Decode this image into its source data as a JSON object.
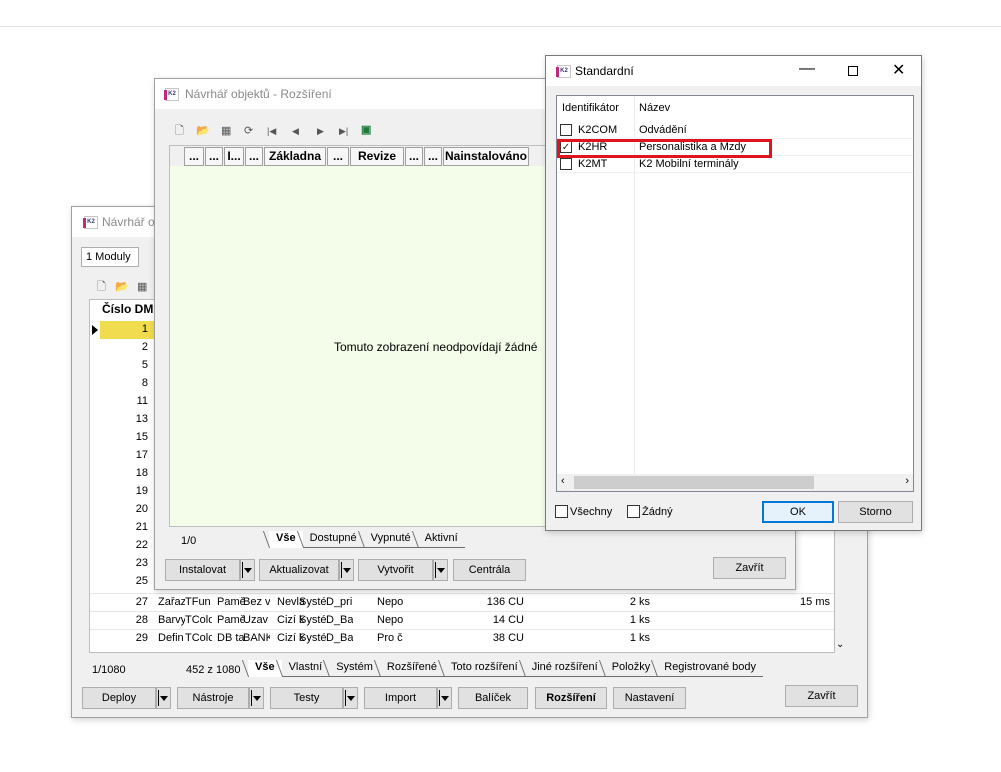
{
  "main_window": {
    "title": "Návrhář ob",
    "module_tab": "1 Moduly",
    "col_header": "Číslo DM",
    "row_numbers": [
      "1",
      "2",
      "5",
      "8",
      "11",
      "13",
      "15",
      "17",
      "18",
      "19",
      "20",
      "21",
      "22",
      "23",
      "25"
    ],
    "rows": [
      {
        "n": "27",
        "c1": "Zařaz",
        "c2": "TFun",
        "c3": "Pamě",
        "c4": "Bez v",
        "c5": "Nevla",
        "c6": "Systé",
        "c7": "D_pri sr",
        "c8": "Nepo",
        "c9": "136 CU",
        "c10": "2 ks",
        "c11": "15 ms"
      },
      {
        "n": "28",
        "c1": "Barvy",
        "c2": "TColc",
        "c3": "Pamě",
        "c4": "Uzav",
        "c5": "Cizí k",
        "c6": "Systé",
        "c7": "D_Ba nz",
        "c8": "Nepo",
        "c9": "14 CU",
        "c10": "1 ks",
        "c11": ""
      },
      {
        "n": "29",
        "c1": "Defin",
        "c2": "TColc",
        "c3": "DB ta",
        "c4": "BANK Bez v",
        "c5": "Cizí k",
        "c6": "Systé",
        "c7": "D_Ba lm",
        "c8": "Pro č",
        "c9": "38 CU",
        "c10": "1 ks",
        "c11": ""
      }
    ],
    "status_left": "1/1080",
    "status_count": "452 z 1080",
    "tabs": [
      "Vše",
      "Vlastní",
      "Systém",
      "Rozšířené",
      "Toto rozšíření",
      "Jiné rozšíření",
      "Položky",
      "Registrované body"
    ],
    "buttons": {
      "deploy": "Deploy",
      "tools": "Nástroje",
      "tests": "Testy",
      "import": "Import",
      "package": "Balíček",
      "extensions": "Rozšíření",
      "settings": "Nastavení",
      "close": "Zavřít"
    }
  },
  "designer_window": {
    "title": "Návrhář objektů - Rozšíření",
    "columns": [
      "...",
      "...",
      "I...",
      "...",
      "Základna",
      "...",
      "Revize",
      "...",
      "...",
      "Nainstalováno"
    ],
    "empty_message": "Tomuto zobrazení neodpovídají žádné",
    "status_left": "1/0",
    "tabs": [
      "Vše",
      "Dostupné",
      "Vypnuté",
      "Aktivní"
    ],
    "buttons": {
      "install": "Instalovat",
      "update": "Aktualizovat",
      "create": "Vytvořit",
      "central": "Centrála",
      "close": "Zavřít"
    }
  },
  "standard_dialog": {
    "title": "Standardní",
    "columns": {
      "id": "Identifikátor",
      "name": "Název"
    },
    "rows": [
      {
        "id": "K2COM",
        "name": "Odvádění",
        "checked": false
      },
      {
        "id": "K2HR",
        "name": "Personalistika a Mzdy",
        "checked": true
      },
      {
        "id": "K2MT",
        "name": "K2 Mobilní terminály",
        "checked": false
      }
    ],
    "all_label": "Všechny",
    "none_label": "Žádný",
    "ok_label": "OK",
    "cancel_label": "Storno",
    "highlight_color": "#e0141e"
  },
  "icons": {
    "logo": "K2"
  }
}
